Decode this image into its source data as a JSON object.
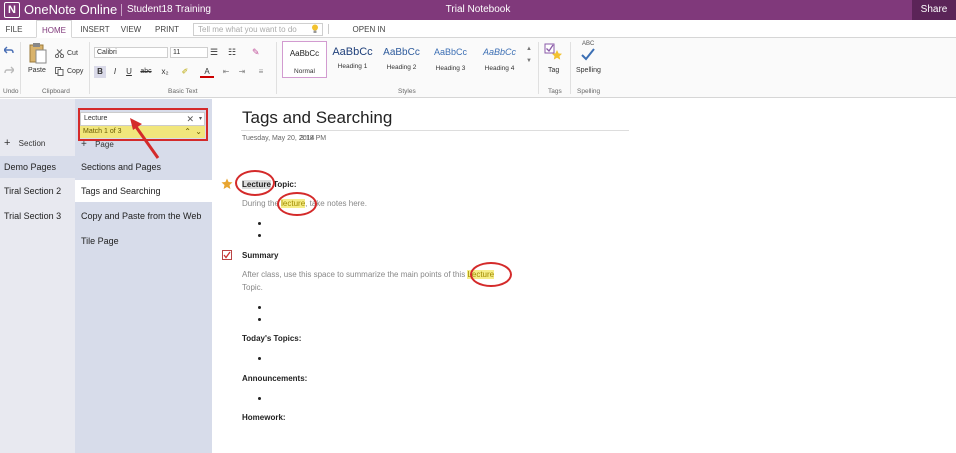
{
  "titlebar": {
    "logo": "N",
    "app_name": "OneNote Online",
    "user_name": "Student18 Training",
    "notebook_name": "Trial Notebook",
    "share_label": "Share"
  },
  "menubar": {
    "tabs": [
      "FILE",
      "HOME",
      "INSERT",
      "VIEW",
      "PRINT"
    ],
    "active_tab": "HOME",
    "tell_me_placeholder": "Tell me what you want to do",
    "open_in_onenote": "OPEN IN ONENOTE"
  },
  "ribbon": {
    "groups": {
      "undo": "Undo",
      "clipboard": "Clipboard",
      "basic_text": "Basic Text",
      "styles": "Styles",
      "tags": "Tags",
      "spelling": "Spelling"
    },
    "clipboard": {
      "paste": "Paste",
      "cut": "Cut",
      "copy": "Copy"
    },
    "font": {
      "name": "Calibri",
      "size": "11"
    },
    "format_buttons": {
      "bold": "B",
      "italic": "I",
      "underline": "U",
      "strikethrough": "abc"
    },
    "styles": [
      {
        "preview": "AaBbCc",
        "name": "Normal",
        "selected": true
      },
      {
        "preview": "AaBbCc",
        "name": "Heading 1"
      },
      {
        "preview": "AaBbCc",
        "name": "Heading 2"
      },
      {
        "preview": "AaBbCc",
        "name": "Heading 3"
      },
      {
        "preview": "AaBbCc",
        "name": "Heading 4"
      }
    ],
    "tag_label": "Tag",
    "spelling_label": "Spelling",
    "spelling_icon_text": "ABC"
  },
  "sections": {
    "add_label": "Section",
    "items": [
      {
        "label": "Demo Pages",
        "selected": true
      },
      {
        "label": "Tiral Section 2"
      },
      {
        "label": "Trial Section 3"
      }
    ]
  },
  "pages": {
    "add_label": "Page",
    "items": [
      {
        "label": "Sections and Pages"
      },
      {
        "label": "Tags and Searching",
        "selected": true
      },
      {
        "label": "Copy and Paste from the Web"
      },
      {
        "label": "Tile Page"
      }
    ]
  },
  "search": {
    "value": "Lecture",
    "match_text": "Match 1 of 3",
    "clear_symbol": "✕",
    "dropdown_symbol": "▾"
  },
  "note": {
    "title": "Tags and Searching",
    "date": "Tuesday, May 20, 2014",
    "time": "3:18 PM",
    "lecture_heading_hl": "Lecture",
    "lecture_heading_rest": " Topic:",
    "during_pre": "During the ",
    "during_hl": "lecture",
    "during_post": ", take notes here.",
    "summary_heading": "Summary",
    "summary_pre": "After class, use this space to summarize the main points of this ",
    "summary_hl": "Lecture",
    "summary_post": "Topic.",
    "todays_topics": "Today's Topics:",
    "announcements": "Announcements:",
    "homework": "Homework:"
  },
  "colors": {
    "brand": "#80397b",
    "highlight": "#f6ee88",
    "annotation_red": "#d42a2a"
  }
}
